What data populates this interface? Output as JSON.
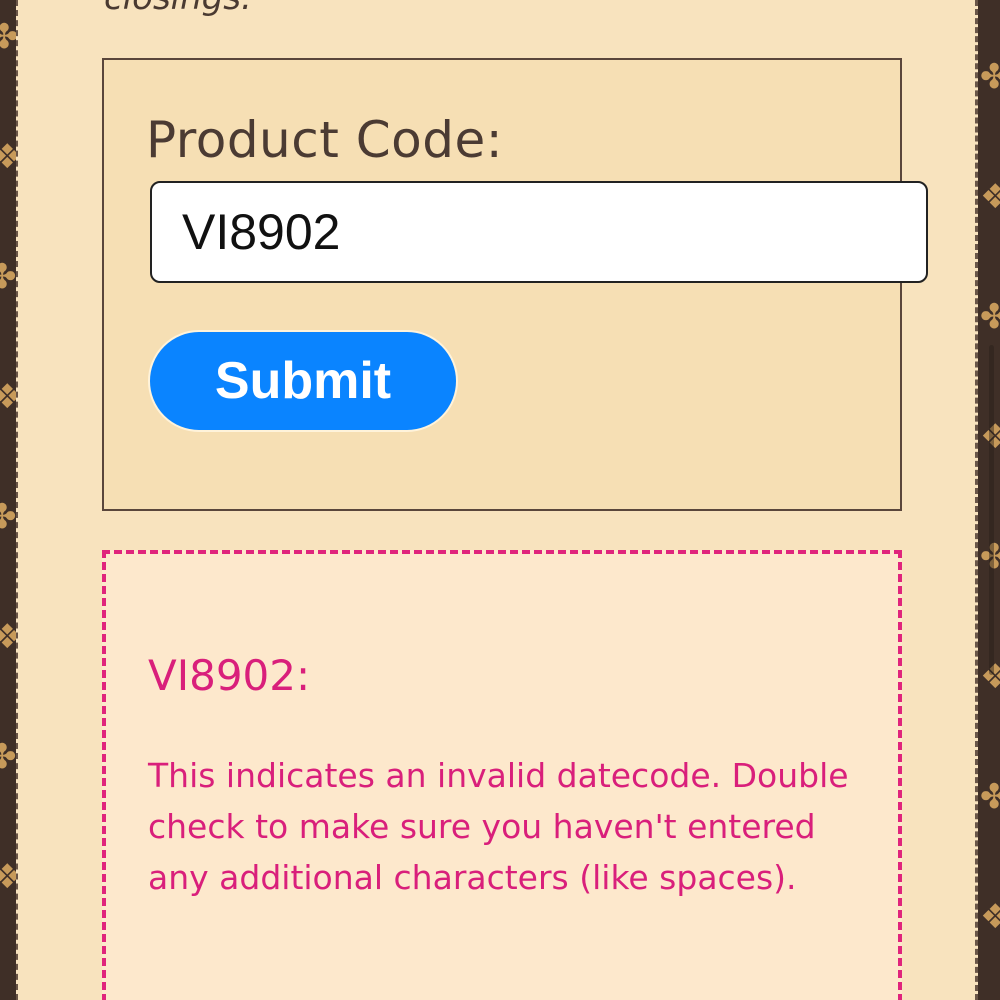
{
  "intro": {
    "partial_text": "closings."
  },
  "form": {
    "label": "Product Code:",
    "input_value": "VI8902",
    "submit_label": "Submit"
  },
  "result": {
    "title": "VI8902:",
    "message": "This indicates an invalid datecode. Double check to make sure you haven't entered any additional characters (like spaces)."
  },
  "colors": {
    "page_background": "#f8e3be",
    "border_brown": "#3f2f27",
    "pattern_gold": "#c79a5a",
    "button_blue": "#0a84ff",
    "result_pink": "#d91f7b"
  },
  "icons": {
    "side_pattern": "monogram-flower-icon"
  }
}
